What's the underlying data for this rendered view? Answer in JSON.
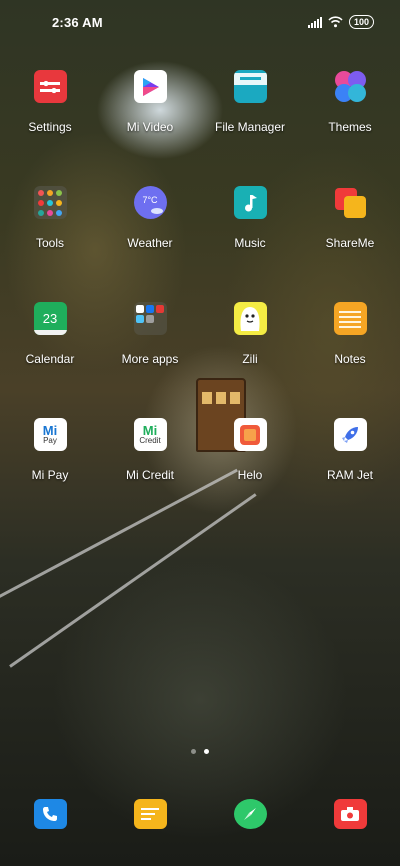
{
  "status_bar": {
    "time": "2:36 AM",
    "battery": "100",
    "icons": [
      "signal-icon",
      "wifi-icon",
      "battery-icon"
    ]
  },
  "apps": [
    {
      "label": "Settings",
      "icon": "settings-icon",
      "color": "#e8383d"
    },
    {
      "label": "Mi Video",
      "icon": "play-icon",
      "color": "#ffffff"
    },
    {
      "label": "File Manager",
      "icon": "folder-icon",
      "color": "#1ba9c1"
    },
    {
      "label": "Themes",
      "icon": "themes-icon",
      "color": "#33b6d9"
    },
    {
      "label": "Tools",
      "icon": "tools-folder-icon",
      "color": "#6b6b5a"
    },
    {
      "label": "Weather",
      "icon": "weather-icon",
      "color": "#6e6ff0",
      "temp": "7°C"
    },
    {
      "label": "Music",
      "icon": "music-icon",
      "color": "#19b0b4"
    },
    {
      "label": "ShareMe",
      "icon": "shareme-icon",
      "color": "#f03a3a"
    },
    {
      "label": "Calendar",
      "icon": "calendar-icon",
      "color": "#1fae5c",
      "date": "23"
    },
    {
      "label": "More apps",
      "icon": "more-apps-folder-icon",
      "color": "#6b6b5a"
    },
    {
      "label": "Zili",
      "icon": "zili-icon",
      "color": "#f4ec44"
    },
    {
      "label": "Notes",
      "icon": "notes-icon",
      "color": "#f5a524"
    },
    {
      "label": "Mi Pay",
      "icon": "mi-pay-icon",
      "color": "#ffffff",
      "brand": "Mi",
      "sub": "Pay"
    },
    {
      "label": "Mi Credit",
      "icon": "mi-credit-icon",
      "color": "#ffffff",
      "brand": "Mi",
      "sub": "Credit"
    },
    {
      "label": "Helo",
      "icon": "helo-icon",
      "color": "#ffffff"
    },
    {
      "label": "RAM Jet",
      "icon": "rocket-icon",
      "color": "#ffffff"
    }
  ],
  "pages": {
    "count": 2,
    "active": 2
  },
  "dock": [
    {
      "icon": "phone-icon",
      "color": "#1e88e5"
    },
    {
      "icon": "messages-icon",
      "color": "#f5b51c"
    },
    {
      "icon": "browser-icon",
      "color": "#2ec86a"
    },
    {
      "icon": "camera-icon",
      "color": "#f03a3a"
    }
  ]
}
